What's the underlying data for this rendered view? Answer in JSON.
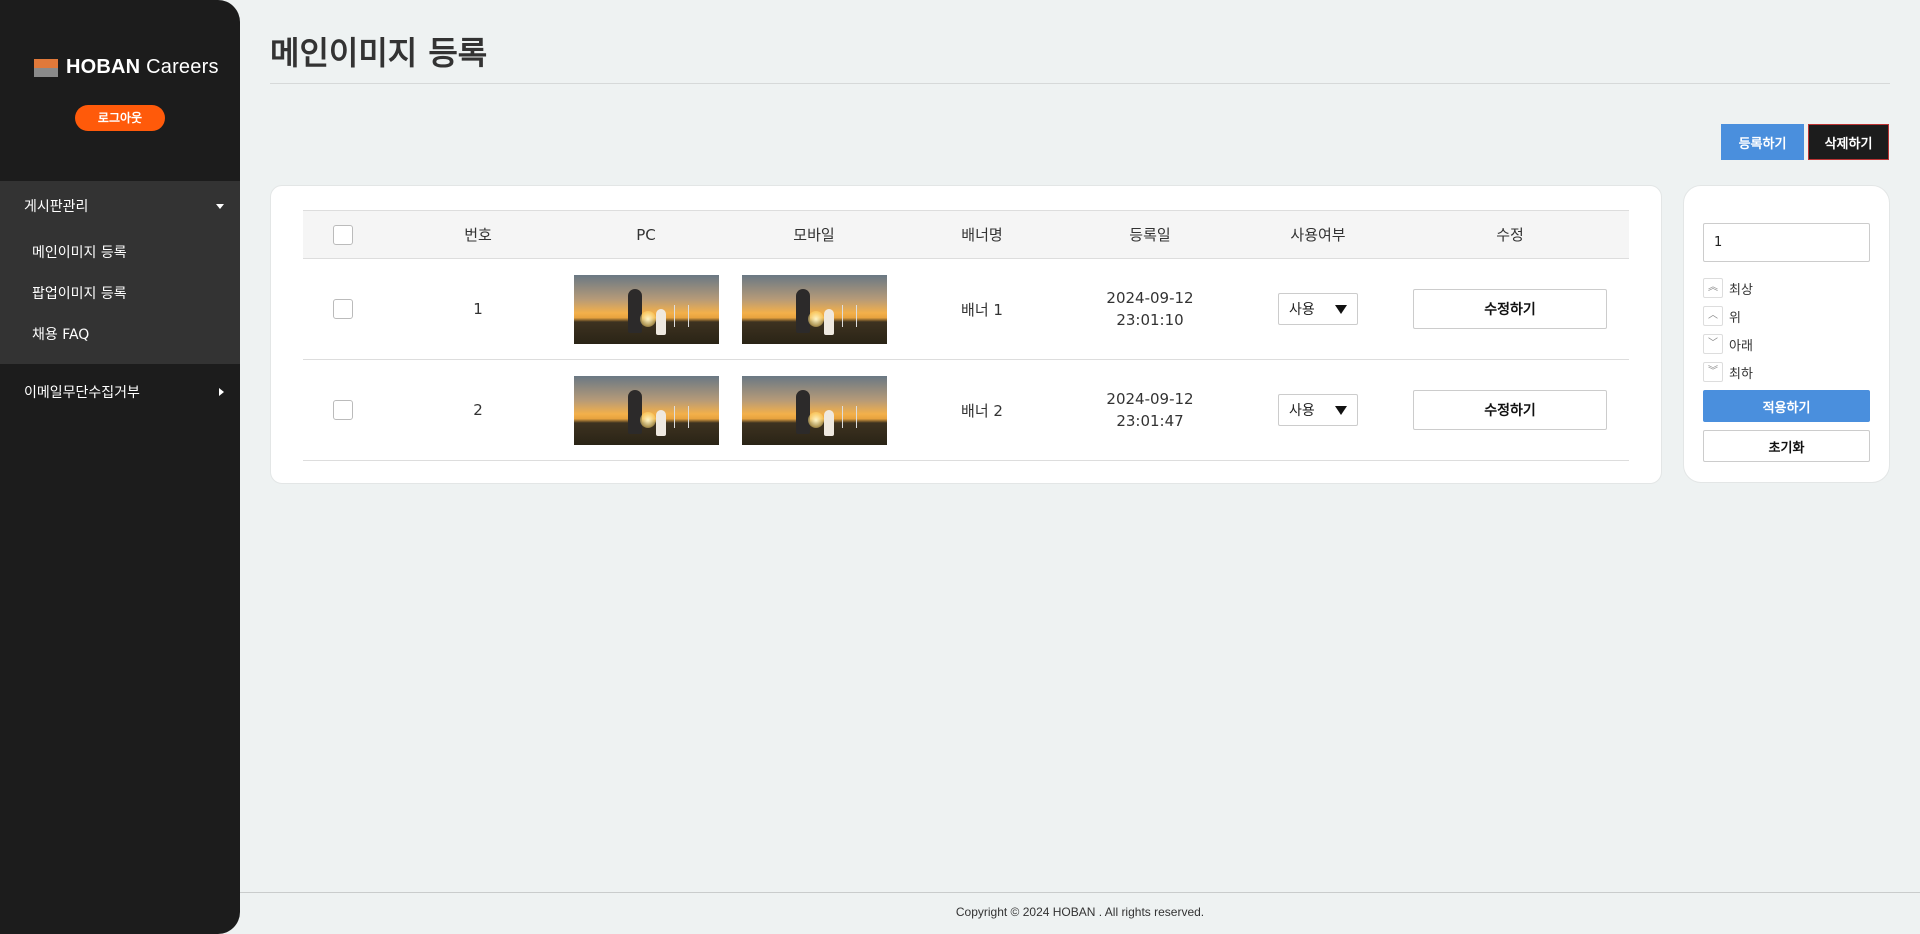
{
  "sidebar": {
    "logo": {
      "brand": "HOBAN",
      "suffix": "Careers"
    },
    "logout_label": "로그아웃",
    "groups": [
      {
        "label": "게시판관리",
        "expanded": true,
        "items": [
          {
            "label": "메인이미지 등록"
          },
          {
            "label": "팝업이미지 등록"
          },
          {
            "label": "채용 FAQ"
          }
        ]
      },
      {
        "label": "이메일무단수집거부",
        "expanded": false
      }
    ]
  },
  "main": {
    "title": "메인이미지 등록",
    "register_label": "등록하기",
    "delete_label": "삭제하기",
    "table": {
      "headers": [
        "번호",
        "PC",
        "모바일",
        "배너명",
        "등록일",
        "사용여부",
        "수정"
      ],
      "rows": [
        {
          "no": "1",
          "name": "배너 1",
          "date": "2024-09-12",
          "time": "23:01:10",
          "use": "사용",
          "edit_label": "수정하기"
        },
        {
          "no": "2",
          "name": "배너 2",
          "date": "2024-09-12",
          "time": "23:01:47",
          "use": "사용",
          "edit_label": "수정하기"
        }
      ]
    }
  },
  "order_panel": {
    "value": "1",
    "moves": [
      {
        "label": "최상",
        "icon": "double-chevron-up-icon"
      },
      {
        "label": "위",
        "icon": "chevron-up-icon"
      },
      {
        "label": "아래",
        "icon": "chevron-down-icon"
      },
      {
        "label": "최하",
        "icon": "double-chevron-down-icon"
      }
    ],
    "apply_label": "적용하기",
    "reset_label": "초기화"
  },
  "footer": {
    "copyright": "Copyright © 2024 HOBAN . All rights reserved."
  },
  "colors": {
    "accent": "#4a8fdd",
    "logout": "#ff5a0a",
    "sidebar": "#1c1c1c"
  }
}
